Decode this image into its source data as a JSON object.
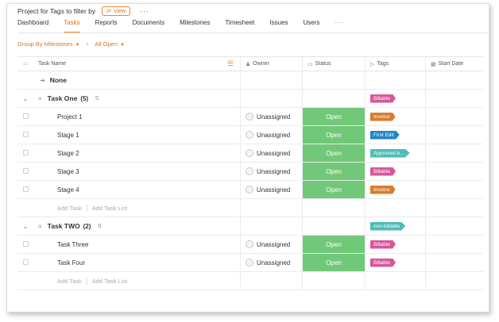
{
  "header": {
    "project_title": "Project for Tags to filter by",
    "view_label": "View",
    "more": "···"
  },
  "tabs": [
    {
      "label": "Dashboard"
    },
    {
      "label": "Tasks",
      "active": true
    },
    {
      "label": "Reports"
    },
    {
      "label": "Documents"
    },
    {
      "label": "Milestones"
    },
    {
      "label": "Timesheet"
    },
    {
      "label": "Issues"
    },
    {
      "label": "Users"
    }
  ],
  "tabs_more": "···",
  "filters": {
    "group_by": "Group By Milestones",
    "status": "All Open"
  },
  "columns": {
    "task_name": "Task Name",
    "owner": "Owner",
    "status": "Status",
    "tags": "Tags",
    "start_date": "Start Date"
  },
  "none_group": "None",
  "groups": [
    {
      "name": "Task One",
      "count": "(5)",
      "tag": {
        "label": "Billable",
        "color": "#d9569b"
      },
      "tasks": [
        {
          "name": "Project 1",
          "owner": "Unassigned",
          "status": "Open",
          "tag": {
            "label": "Invoice",
            "color": "#d97b2e"
          }
        },
        {
          "name": "Stage 1",
          "owner": "Unassigned",
          "status": "Open",
          "tag": {
            "label": "First Edit",
            "color": "#1f87c9"
          }
        },
        {
          "name": "Stage 2",
          "owner": "Unassigned",
          "status": "Open",
          "tag": {
            "label": "Approved b...",
            "color": "#4dbcb6"
          }
        },
        {
          "name": "Stage 3",
          "owner": "Unassigned",
          "status": "Open",
          "tag": {
            "label": "Billable",
            "color": "#d9569b"
          }
        },
        {
          "name": "Stage 4",
          "owner": "Unassigned",
          "status": "Open",
          "tag": {
            "label": "Invoice",
            "color": "#d97b2e"
          }
        }
      ]
    },
    {
      "name": "Task TWO",
      "count": "(2)",
      "tag": {
        "label": "non-billable",
        "color": "#4dbcb6"
      },
      "tasks": [
        {
          "name": "Task Three",
          "owner": "Unassigned",
          "status": "Open",
          "tag": {
            "label": "Billable",
            "color": "#d9569b"
          }
        },
        {
          "name": "Task Four",
          "owner": "Unassigned",
          "status": "Open",
          "tag": {
            "label": "Billable",
            "color": "#d9569b"
          }
        }
      ]
    }
  ],
  "add_task": "Add Task",
  "add_task_list": "Add Task List",
  "colors": {
    "accent": "#f08a24",
    "status_open": "#72c879"
  },
  "icons": {
    "view": "view-icon",
    "expand_all": "double-chevron-icon",
    "column_settings": "list-settings-icon",
    "owner": "person-icon",
    "status": "status-icon",
    "tags": "tag-icon",
    "start_date": "calendar-icon",
    "drag": "drag-handle-icon",
    "sort": "sort-icon"
  }
}
